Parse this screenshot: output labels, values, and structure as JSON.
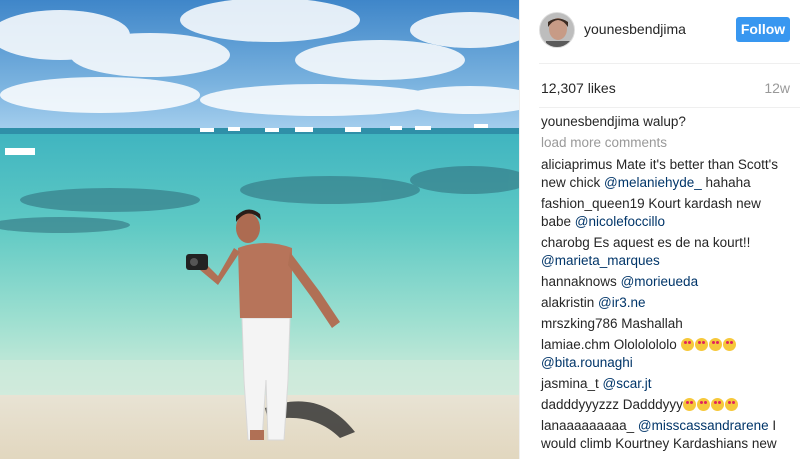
{
  "post": {
    "username": "younesbendjima",
    "follow_label": "Follow",
    "likes": "12,307 likes",
    "age": "12w",
    "caption": {
      "user": "younesbendjima",
      "text": " walup?"
    },
    "load_more": "load more comments"
  },
  "comments": [
    {
      "user": "aliciaprimus",
      "text": " Mate it's better than Scott's new chick ",
      "mention": "@melaniehyde_",
      "tail": " hahaha",
      "emojis": 0
    },
    {
      "user": "fashion_queen19",
      "text": " Kourt kardash new babe ",
      "mention": "@nicolefoccillo",
      "tail": "",
      "emojis": 0
    },
    {
      "user": "charobg",
      "text": " Es aquest es de na kourt!! ",
      "mention": "@marieta_marques",
      "tail": "",
      "emojis": 0
    },
    {
      "user": "hannaknows",
      "text": " ",
      "mention": "@morieueda",
      "tail": "",
      "emojis": 0
    },
    {
      "user": "alakristin",
      "text": " ",
      "mention": "@ir3.ne",
      "tail": "",
      "emojis": 0
    },
    {
      "user": "mrszking786",
      "text": " Mashallah",
      "mention": "",
      "tail": "",
      "emojis": 0
    },
    {
      "user": "lamiae.chm",
      "text": " Olololololo ",
      "mention": "@bita.rounaghi",
      "tail": "",
      "emojis": 4
    },
    {
      "user": "jasmina_t",
      "text": " ",
      "mention": "@scar.jt",
      "tail": "",
      "emojis": 0
    },
    {
      "user": "dadddyyyzzz",
      "text": " Dadddyyy",
      "mention": "",
      "tail": "",
      "emojis": 4
    },
    {
      "user": "lanaaaaaaaaa_",
      "text": " ",
      "mention": "@misscassandrarene",
      "tail": " I would climb Kourtney Kardashians new",
      "emojis": 0
    }
  ],
  "icons": {
    "avatar": "profile-avatar",
    "emoji": "heart-eyes-emoji"
  },
  "colors": {
    "follow": "#3897f0",
    "mention": "#003569",
    "muted": "#999999"
  }
}
